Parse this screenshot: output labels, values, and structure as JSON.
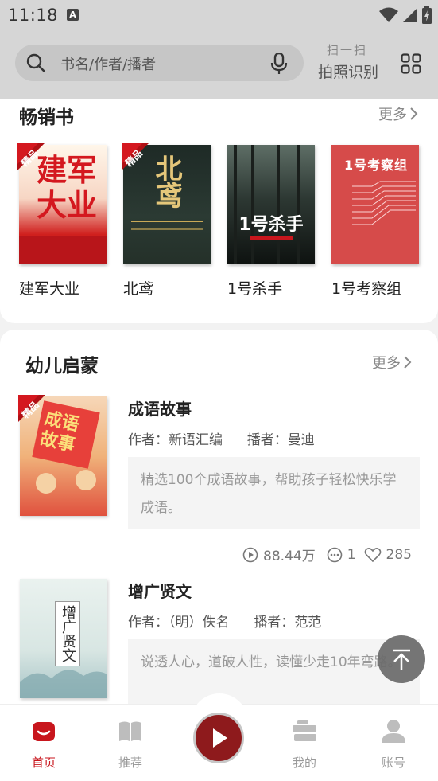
{
  "status_bar": {
    "time": "11:18",
    "notification_letter": "A"
  },
  "header": {
    "search_placeholder": "书名/作者/播者",
    "scan_top": "扫一扫",
    "scan_bottom": "拍照识别"
  },
  "bestseller": {
    "title": "畅销书",
    "more": "更多",
    "books": [
      {
        "name": "建军大业",
        "cover_text": "建军大业",
        "badge": "精品"
      },
      {
        "name": "北鸢",
        "cover_text": "北鸢",
        "badge": "精品"
      },
      {
        "name": "1号杀手",
        "cover_text": "1号杀手"
      },
      {
        "name": "1号考察组",
        "cover_text": "1号考察组"
      }
    ]
  },
  "kids": {
    "title": "幼儿启蒙",
    "more": "更多",
    "items": [
      {
        "title": "成语故事",
        "author_label": "作者：",
        "author": "新语汇编",
        "narrator_label": "播者：",
        "narrator": "曼迪",
        "desc": "精选100个成语故事，帮助孩子轻松快乐学成语。",
        "badge": "精品",
        "cover_text": "成语故事",
        "plays": "88.44万",
        "comments": "1",
        "likes": "285"
      },
      {
        "title": "增广贤文",
        "author_label": "作者：",
        "author": "（明）佚名",
        "narrator_label": "播者：",
        "narrator": "范范",
        "desc": "说透人心，道破人性，读懂少走10年弯路。",
        "cover_text": "增广贤文"
      }
    ]
  },
  "nav": {
    "home": "首页",
    "recommend": "推荐",
    "mine": "我的",
    "account": "账号"
  },
  "colors": {
    "accent": "#c8161d",
    "play": "#8e1a1c"
  }
}
